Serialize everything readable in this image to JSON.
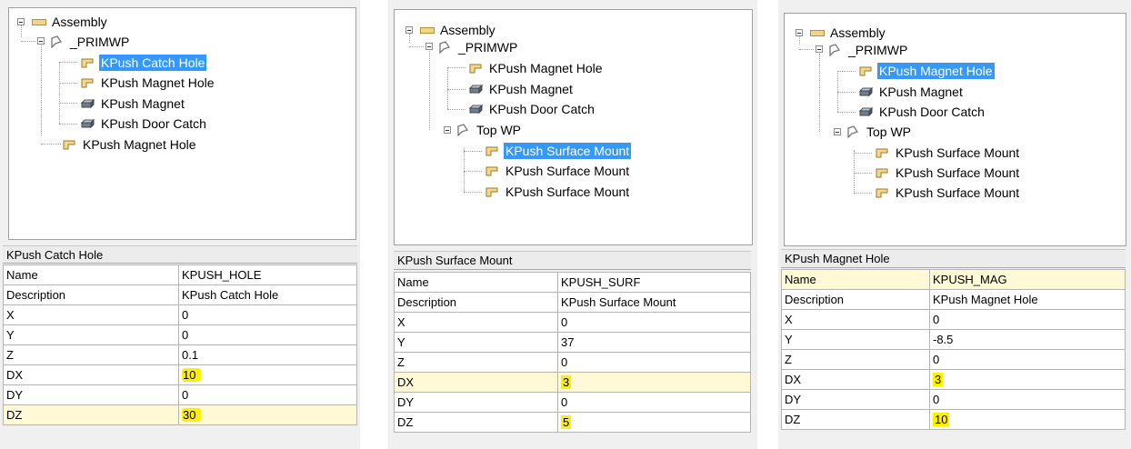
{
  "panels": [
    {
      "tree": {
        "root": "Assembly",
        "wp": "_PRIMWP",
        "children": [
          "KPush Catch Hole",
          "KPush Magnet Hole",
          "KPush Magnet",
          "KPush Door Catch"
        ],
        "sibling": "KPush Magnet Hole"
      },
      "header": "KPush Catch Hole",
      "rows": [
        {
          "label": "Name",
          "value": "KPUSH_HOLE"
        },
        {
          "label": "Description",
          "value": "KPush Catch Hole"
        },
        {
          "label": "X",
          "value": "0"
        },
        {
          "label": "Y",
          "value": "0"
        },
        {
          "label": "Z",
          "value": "0.1"
        },
        {
          "label": "DX",
          "value": "10"
        },
        {
          "label": "DY",
          "value": "0"
        },
        {
          "label": "DZ",
          "value": "30"
        }
      ]
    },
    {
      "tree": {
        "root": "Assembly",
        "wp": "_PRIMWP",
        "children": [
          "KPush Magnet Hole",
          "KPush Magnet",
          "KPush Door Catch"
        ],
        "sub_wp": "Top WP",
        "sub_children": [
          "KPush Surface Mount",
          "KPush Surface Mount",
          "KPush Surface Mount"
        ]
      },
      "header": "KPush Surface Mount",
      "rows": [
        {
          "label": "Name",
          "value": "KPUSH_SURF"
        },
        {
          "label": "Description",
          "value": "KPush Surface Mount"
        },
        {
          "label": "X",
          "value": "0"
        },
        {
          "label": "Y",
          "value": "37"
        },
        {
          "label": "Z",
          "value": "0"
        },
        {
          "label": "DX",
          "value": "3"
        },
        {
          "label": "DY",
          "value": "0"
        },
        {
          "label": "DZ",
          "value": "5"
        }
      ]
    },
    {
      "tree": {
        "root": "Assembly",
        "wp": "_PRIMWP",
        "children": [
          "KPush Magnet Hole",
          "KPush Magnet",
          "KPush Door Catch"
        ],
        "sub_wp": "Top WP",
        "sub_children": [
          "KPush Surface Mount",
          "KPush Surface Mount",
          "KPush Surface Mount"
        ]
      },
      "header": "KPush Magnet Hole",
      "rows": [
        {
          "label": "Name",
          "value": "KPUSH_MAG"
        },
        {
          "label": "Description",
          "value": "KPush Magnet Hole"
        },
        {
          "label": "X",
          "value": "0"
        },
        {
          "label": "Y",
          "value": "-8.5"
        },
        {
          "label": "Z",
          "value": "0"
        },
        {
          "label": "DX",
          "value": "3"
        },
        {
          "label": "DY",
          "value": "0"
        },
        {
          "label": "DZ",
          "value": "10"
        }
      ]
    }
  ]
}
